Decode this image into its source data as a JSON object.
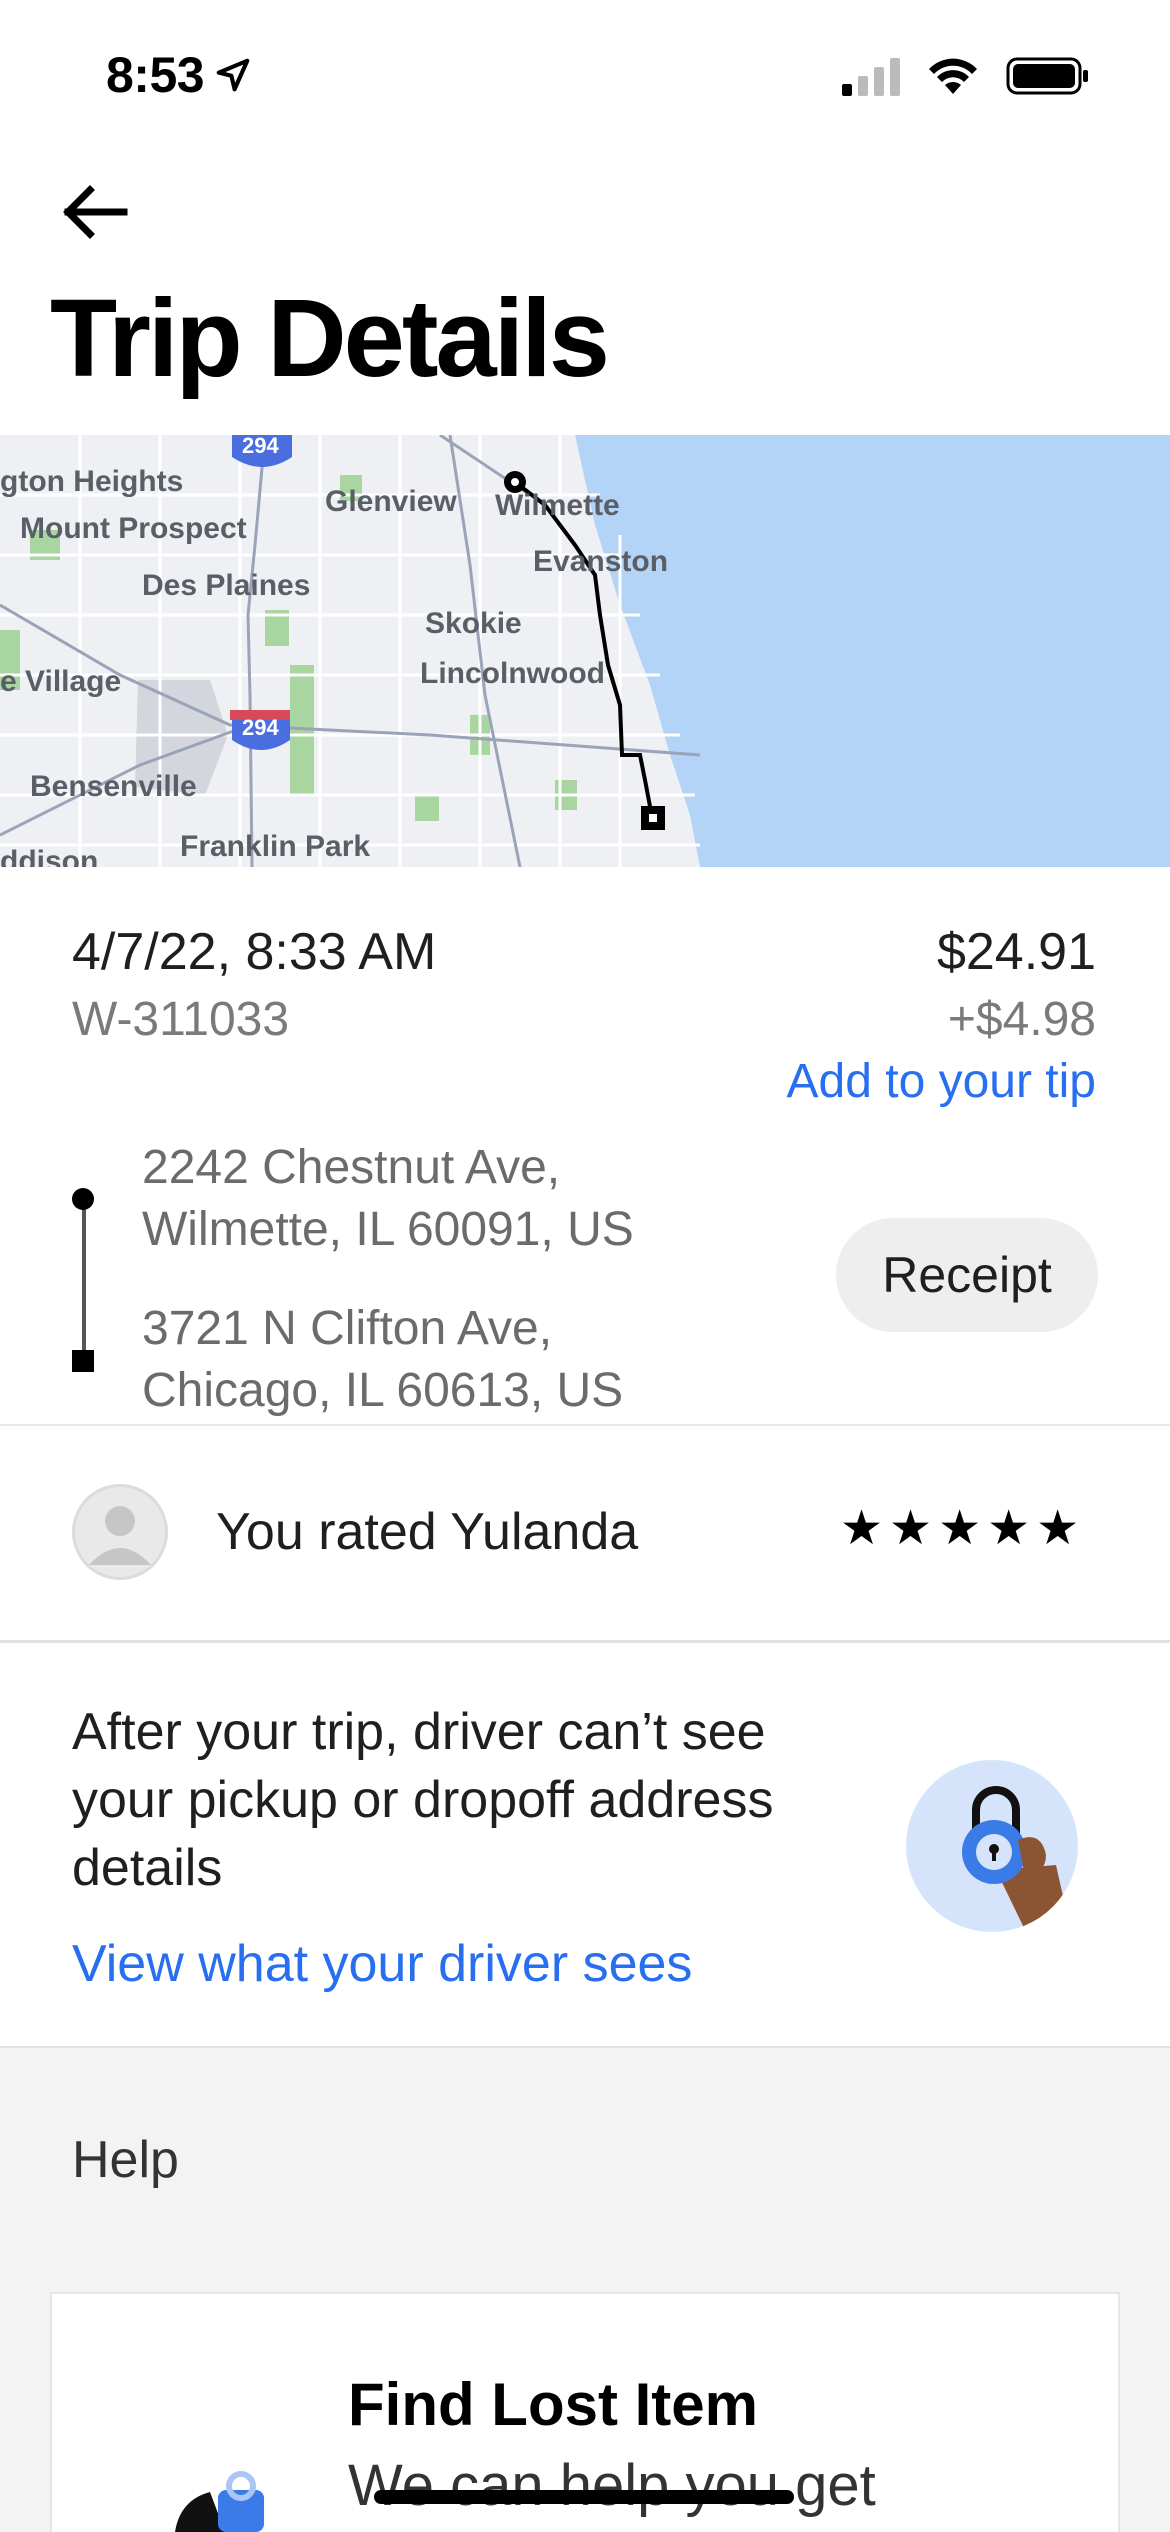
{
  "status_bar": {
    "time": "8:53"
  },
  "header": {
    "title": "Trip Details"
  },
  "map": {
    "labels": [
      "gton Heights",
      "Mount Prospect",
      "Des Plaines",
      "Glenview",
      "Wilmette",
      "Evanston",
      "Skokie",
      "Lincolnwood",
      "e Village",
      "Bensenville",
      "Franklin Park",
      "ddison"
    ],
    "shields": [
      "294",
      "294"
    ]
  },
  "trip": {
    "date_time": "4/7/22, 8:33 AM",
    "trip_id": "W-311033",
    "fare": "$24.91",
    "tip": "+$4.98",
    "add_tip_label": "Add to your tip",
    "pickup_line1": "2242 Chestnut Ave,",
    "pickup_line2": "Wilmette, IL 60091, US",
    "dropoff_line1": "3721 N Clifton Ave,",
    "dropoff_line2": "Chicago, IL 60613, US",
    "receipt_label": "Receipt"
  },
  "rating": {
    "text": "You rated Yulanda",
    "stars": "★★★★★"
  },
  "privacy": {
    "text": "After your trip, driver can’t see your pickup or dropoff address details",
    "link": "View what your driver sees"
  },
  "help": {
    "title": "Help",
    "card_title": "Find Lost Item",
    "card_subtitle": "We can help you get"
  },
  "colors": {
    "accent": "#276ef1",
    "water": "#b3d4f7",
    "park": "#a9d6a0"
  }
}
